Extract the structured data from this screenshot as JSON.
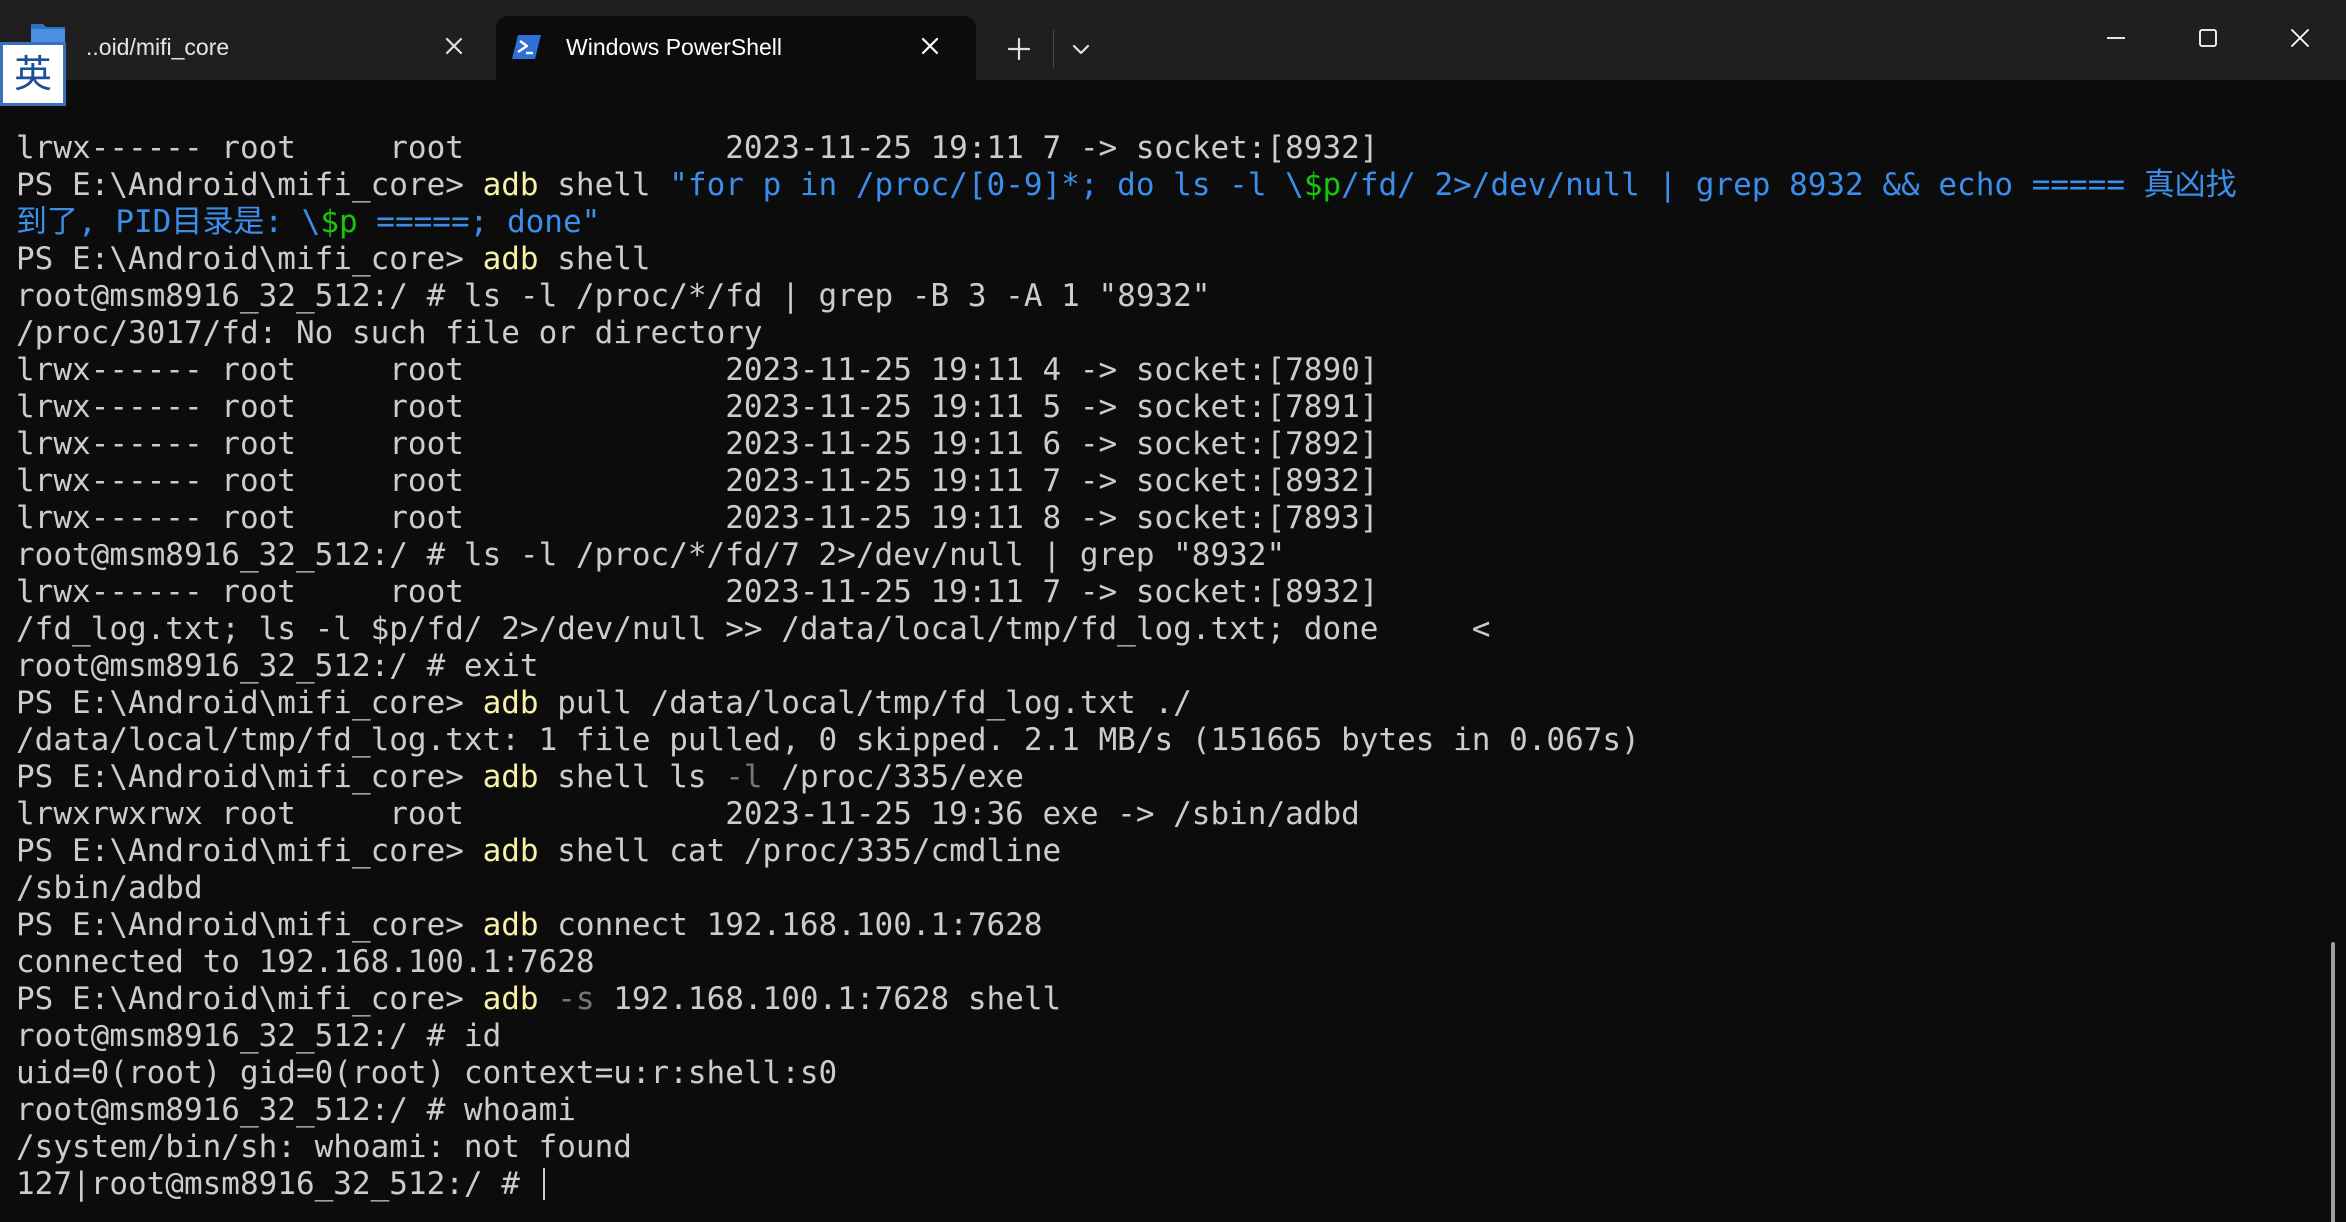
{
  "window": {
    "tabs": [
      {
        "label": "..oid/mifi_core",
        "active": false,
        "icon": "folder-icon"
      },
      {
        "label": "Windows PowerShell",
        "active": true,
        "icon": "powershell-icon"
      }
    ],
    "ime_indicator": "英",
    "controls": [
      "new-tab",
      "dropdown",
      "minimize",
      "maximize",
      "close"
    ]
  },
  "colors": {
    "background": "#0c0c0c",
    "titlebar": "#1f1f1f",
    "text": "#cccccc",
    "command": "#f9f1a5",
    "string": "#3b8eea",
    "variable": "#16c60c",
    "parameter": "#767676"
  },
  "terminal": {
    "lines": [
      [
        {
          "t": "lrwx------ root     root              2023-11-25 19:11 7 -> socket:[8932]",
          "c": "def"
        }
      ],
      [
        {
          "t": "PS E:\\Android\\mifi_core> ",
          "c": "def"
        },
        {
          "t": "adb",
          "c": "yel"
        },
        {
          "t": " shell ",
          "c": "def"
        },
        {
          "t": "\"for p in /proc/[0-9]*; do ls -l \\",
          "c": "blue"
        },
        {
          "t": "$p",
          "c": "grn"
        },
        {
          "t": "/fd/ 2>/dev/null | grep 8932 && echo ===== 真凶找",
          "c": "blue"
        }
      ],
      [
        {
          "t": "到了, PID目录是: \\",
          "c": "blue"
        },
        {
          "t": "$p",
          "c": "grn"
        },
        {
          "t": " =====; done\"",
          "c": "blue"
        }
      ],
      [
        {
          "t": "PS E:\\Android\\mifi_core> ",
          "c": "def"
        },
        {
          "t": "adb",
          "c": "yel"
        },
        {
          "t": " shell",
          "c": "def"
        }
      ],
      [
        {
          "t": "root@msm8916_32_512:/ # ls -l /proc/*/fd | grep -B 3 -A 1 \"8932\"",
          "c": "def"
        }
      ],
      [
        {
          "t": "/proc/3017/fd: No such file or directory",
          "c": "def"
        }
      ],
      [
        {
          "t": "lrwx------ root     root              2023-11-25 19:11 4 -> socket:[7890]",
          "c": "def"
        }
      ],
      [
        {
          "t": "lrwx------ root     root              2023-11-25 19:11 5 -> socket:[7891]",
          "c": "def"
        }
      ],
      [
        {
          "t": "lrwx------ root     root              2023-11-25 19:11 6 -> socket:[7892]",
          "c": "def"
        }
      ],
      [
        {
          "t": "lrwx------ root     root              2023-11-25 19:11 7 -> socket:[8932]",
          "c": "def"
        }
      ],
      [
        {
          "t": "lrwx------ root     root              2023-11-25 19:11 8 -> socket:[7893]",
          "c": "def"
        }
      ],
      [
        {
          "t": "root@msm8916_32_512:/ # ls -l /proc/*/fd/7 2>/dev/null | grep \"8932\"",
          "c": "def"
        }
      ],
      [
        {
          "t": "lrwx------ root     root              2023-11-25 19:11 7 -> socket:[8932]",
          "c": "def"
        }
      ],
      [
        {
          "t": "/fd_log.txt; ls -l $p/fd/ 2>/dev/null >> /data/local/tmp/fd_log.txt; done     <",
          "c": "def"
        }
      ],
      [
        {
          "t": "root@msm8916_32_512:/ # exit",
          "c": "def"
        }
      ],
      [
        {
          "t": "PS E:\\Android\\mifi_core> ",
          "c": "def"
        },
        {
          "t": "adb",
          "c": "yel"
        },
        {
          "t": " pull /data/local/tmp/fd_log.txt ./",
          "c": "def"
        }
      ],
      [
        {
          "t": "/data/local/tmp/fd_log.txt: 1 file pulled, 0 skipped. 2.1 MB/s (151665 bytes in 0.067s)",
          "c": "def"
        }
      ],
      [
        {
          "t": "PS E:\\Android\\mifi_core> ",
          "c": "def"
        },
        {
          "t": "adb",
          "c": "yel"
        },
        {
          "t": " shell ls ",
          "c": "def"
        },
        {
          "t": "-l",
          "c": "gray"
        },
        {
          "t": " /proc/335/exe",
          "c": "def"
        }
      ],
      [
        {
          "t": "lrwxrwxrwx root     root              2023-11-25 19:36 exe -> /sbin/adbd",
          "c": "def"
        }
      ],
      [
        {
          "t": "PS E:\\Android\\mifi_core> ",
          "c": "def"
        },
        {
          "t": "adb",
          "c": "yel"
        },
        {
          "t": " shell cat /proc/335/cmdline",
          "c": "def"
        }
      ],
      [
        {
          "t": "/sbin/adbd",
          "c": "def"
        }
      ],
      [
        {
          "t": "PS E:\\Android\\mifi_core> ",
          "c": "def"
        },
        {
          "t": "adb",
          "c": "yel"
        },
        {
          "t": " connect 192.168.100.1:7628",
          "c": "def"
        }
      ],
      [
        {
          "t": "connected to 192.168.100.1:7628",
          "c": "def"
        }
      ],
      [
        {
          "t": "PS E:\\Android\\mifi_core> ",
          "c": "def"
        },
        {
          "t": "adb",
          "c": "yel"
        },
        {
          "t": " ",
          "c": "def"
        },
        {
          "t": "-s",
          "c": "gray"
        },
        {
          "t": " 192.168.100.1:7628 shell",
          "c": "def"
        }
      ],
      [
        {
          "t": "root@msm8916_32_512:/ # id",
          "c": "def"
        }
      ],
      [
        {
          "t": "uid=0(root) gid=0(root) context=u:r:shell:s0",
          "c": "def"
        }
      ],
      [
        {
          "t": "root@msm8916_32_512:/ # whoami",
          "c": "def"
        }
      ],
      [
        {
          "t": "/system/bin/sh: whoami: not found",
          "c": "def"
        }
      ],
      [
        {
          "t": "127|root@msm8916_32_512:/ # ",
          "c": "def"
        }
      ]
    ]
  }
}
